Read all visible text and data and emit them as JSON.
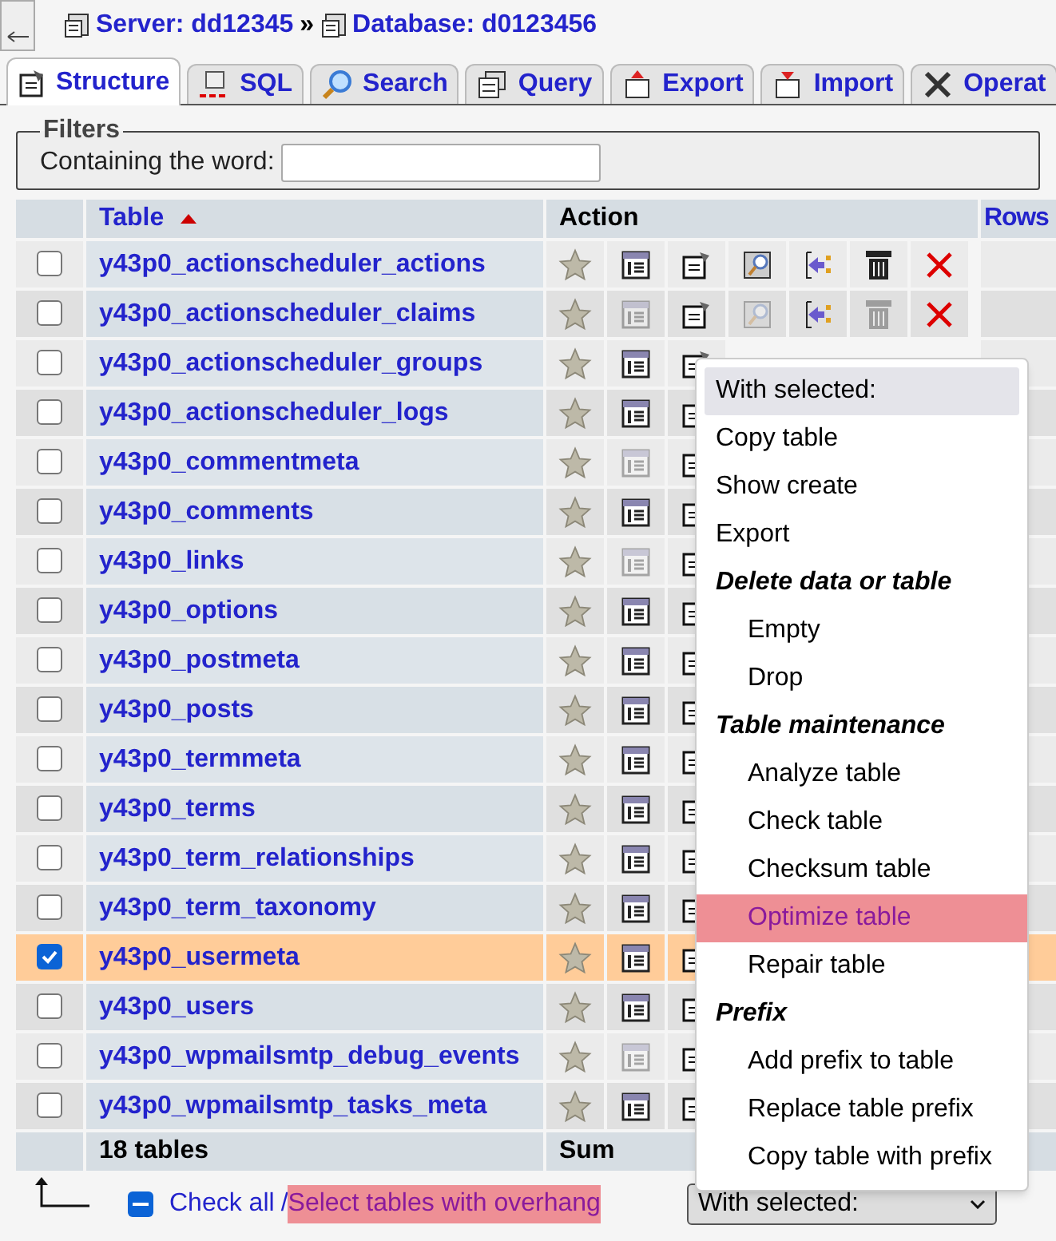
{
  "breadcrumb": {
    "server": "Server: dd12345",
    "separator": "»",
    "database": "Database: d0123456"
  },
  "tabs": [
    {
      "label": "Structure",
      "selected": true
    },
    {
      "label": "SQL",
      "selected": false
    },
    {
      "label": "Search",
      "selected": false
    },
    {
      "label": "Query",
      "selected": false
    },
    {
      "label": "Export",
      "selected": false
    },
    {
      "label": "Import",
      "selected": false
    },
    {
      "label": "Operat",
      "selected": false
    }
  ],
  "filters": {
    "legend": "Filters",
    "label": "Containing the word:"
  },
  "table": {
    "columns": [
      {
        "label": "Table",
        "sorted": true
      },
      {
        "label": "Action",
        "sorted": false
      },
      {
        "label": "Rows",
        "sorted": false
      }
    ],
    "rows": [
      {
        "name": "y43p0_actionscheduler_actions",
        "checked": false,
        "empty": false
      },
      {
        "name": "y43p0_actionscheduler_claims",
        "checked": false,
        "empty": true
      },
      {
        "name": "y43p0_actionscheduler_groups",
        "checked": false,
        "empty": false
      },
      {
        "name": "y43p0_actionscheduler_logs",
        "checked": false,
        "empty": false
      },
      {
        "name": "y43p0_commentmeta",
        "checked": false,
        "empty": true
      },
      {
        "name": "y43p0_comments",
        "checked": false,
        "empty": false
      },
      {
        "name": "y43p0_links",
        "checked": false,
        "empty": true
      },
      {
        "name": "y43p0_options",
        "checked": false,
        "empty": false
      },
      {
        "name": "y43p0_postmeta",
        "checked": false,
        "empty": false
      },
      {
        "name": "y43p0_posts",
        "checked": false,
        "empty": false
      },
      {
        "name": "y43p0_termmeta",
        "checked": false,
        "empty": false
      },
      {
        "name": "y43p0_terms",
        "checked": false,
        "empty": false
      },
      {
        "name": "y43p0_term_relationships",
        "checked": false,
        "empty": false
      },
      {
        "name": "y43p0_term_taxonomy",
        "checked": false,
        "empty": false
      },
      {
        "name": "y43p0_usermeta",
        "checked": true,
        "empty": false
      },
      {
        "name": "y43p0_users",
        "checked": false,
        "empty": false
      },
      {
        "name": "y43p0_wpmailsmtp_debug_events",
        "checked": false,
        "empty": true
      },
      {
        "name": "y43p0_wpmailsmtp_tasks_meta",
        "checked": false,
        "empty": false
      }
    ],
    "footer": {
      "count": "18 tables",
      "sum": "Sum"
    }
  },
  "bulk": {
    "check_all_mixed": true,
    "check_all": "Check all",
    "separator": "/",
    "overhang": "Select tables with overhang",
    "overhang_highlighted": true,
    "select": "With selected:"
  },
  "menu": [
    {
      "kind": "header",
      "label": "With selected:"
    },
    {
      "kind": "option",
      "label": "Copy table",
      "selected": false
    },
    {
      "kind": "option",
      "label": "Show create",
      "selected": false
    },
    {
      "kind": "option",
      "label": "Export",
      "selected": false
    },
    {
      "kind": "group",
      "label": "Delete data or table"
    },
    {
      "kind": "suboption",
      "label": "Empty",
      "selected": false
    },
    {
      "kind": "suboption",
      "label": "Drop",
      "selected": false
    },
    {
      "kind": "group",
      "label": "Table maintenance"
    },
    {
      "kind": "suboption",
      "label": "Analyze table",
      "selected": false
    },
    {
      "kind": "suboption",
      "label": "Check table",
      "selected": false
    },
    {
      "kind": "suboption",
      "label": "Checksum table",
      "selected": false
    },
    {
      "kind": "suboption",
      "label": "Optimize table",
      "selected": true
    },
    {
      "kind": "suboption",
      "label": "Repair table",
      "selected": false
    },
    {
      "kind": "group",
      "label": "Prefix"
    },
    {
      "kind": "suboption",
      "label": "Add prefix to table",
      "selected": false
    },
    {
      "kind": "suboption",
      "label": "Replace table prefix",
      "selected": false
    },
    {
      "kind": "suboption",
      "label": "Copy table with prefix",
      "selected": false
    }
  ]
}
